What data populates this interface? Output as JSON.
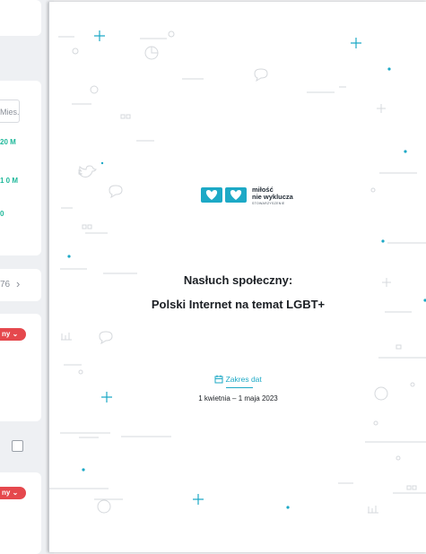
{
  "background_app": {
    "view_toggle_label": "Mies.",
    "stats": [
      {
        "value": "20 M"
      },
      {
        "value": "1 0 M"
      },
      {
        "value": "0"
      }
    ],
    "pager_value": "76",
    "pager_next_glyph": "›",
    "sentiment_pill_1": "ny",
    "sentiment_pill_2": "ny"
  },
  "report": {
    "logo": {
      "line1": "miłość",
      "line2": "nie wyklucza",
      "line3": "STOWARZYSZENIE"
    },
    "title_line1": "Nasłuch społeczny:",
    "title_line2": "Polski Internet na temat LGBT+",
    "date_label": "Zakres dat",
    "date_range": "1 kwietnia – 1 maja 2023"
  },
  "colors": {
    "accent": "#1da9c6",
    "green": "#1fb89a",
    "pill": "#e5484d"
  }
}
